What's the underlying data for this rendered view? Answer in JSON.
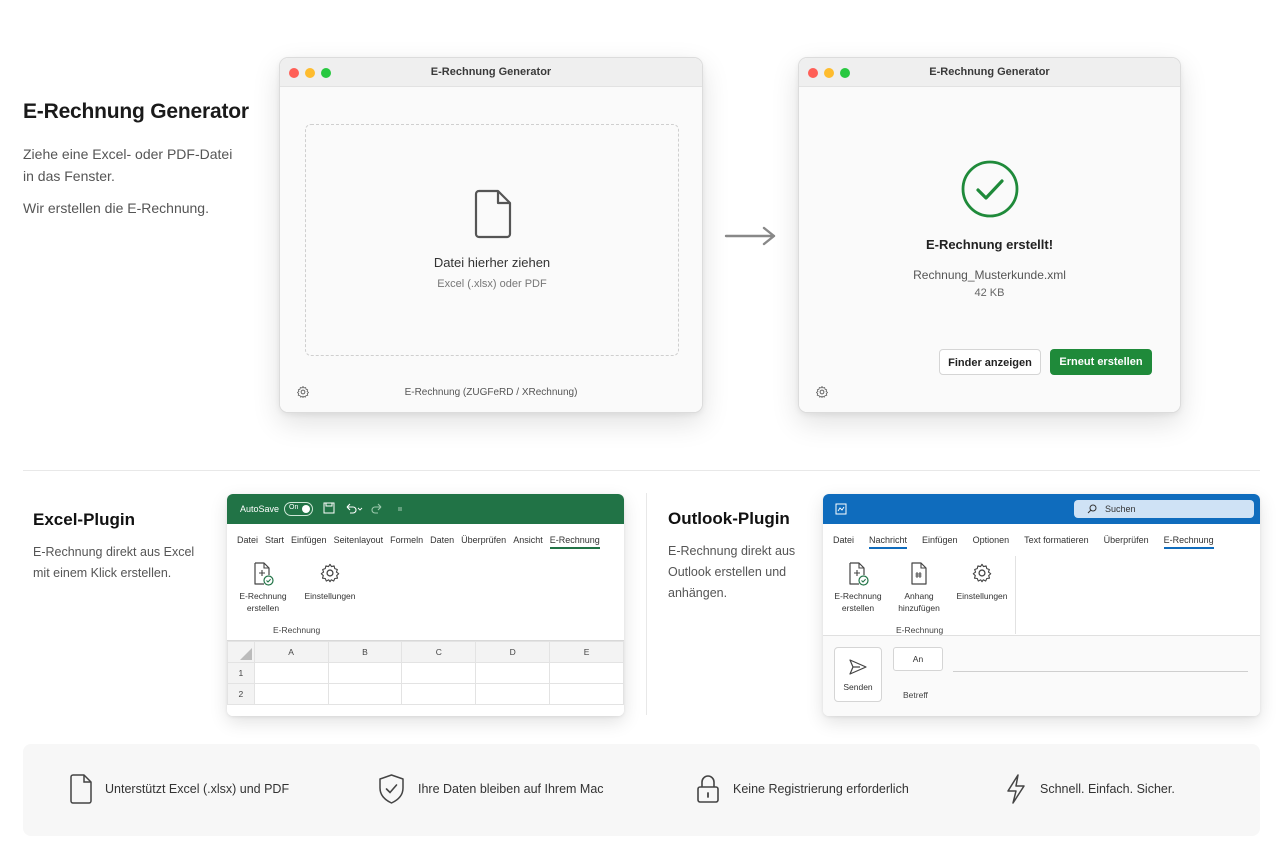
{
  "intro": {
    "title": "E-Rechnung Generator",
    "line1": "Ziehe eine Excel- oder PDF-Datei in das Fenster.",
    "line2": "Wir erstellen die E-Rechnung."
  },
  "window_left": {
    "title": "E-Rechnung Generator",
    "drop_title": "Datei hierher ziehen",
    "drop_subtitle": "Excel (.xlsx) oder PDF",
    "footer": "E-Rechnung (ZUGFeRD / XRechnung)"
  },
  "window_right": {
    "title": "E-Rechnung Generator",
    "status": "E-Rechnung erstellt!",
    "filename": "Rechnung_Musterkunde.xml",
    "filesize": "42 KB",
    "secondary_button": "Finder anzeigen",
    "primary_button": "Erneut erstellen"
  },
  "excel_plugin": {
    "title": "Excel-Plugin",
    "description": "E-Rechnung direkt aus Excel mit einem Klick erstellen.",
    "autosave": "AutoSave",
    "toggle": "On",
    "tabs": [
      "Datei",
      "Start",
      "Einfügen",
      "Seitenlayout",
      "Formeln",
      "Daten",
      "Überprüfen",
      "Ansicht",
      "E-Rechnung"
    ],
    "btn_create_line1": "E-Rechnung",
    "btn_create_line2": "erstellen",
    "btn_settings": "Einstellungen",
    "group": "E-Rechnung",
    "columns": [
      "A",
      "B",
      "C",
      "D",
      "E"
    ],
    "rows": [
      "1",
      "2"
    ]
  },
  "outlook_plugin": {
    "title": "Outlook-Plugin",
    "description": "E-Rechnung direkt aus Outlook erstellen und anhängen.",
    "search": "Suchen",
    "tabs": [
      "Datei",
      "Nachricht",
      "Einfügen",
      "Optionen",
      "Text formatieren",
      "Überprüfen",
      "E-Rechnung"
    ],
    "btn_create_line1": "E-Rechnung",
    "btn_create_line2": "erstellen",
    "btn_attach_line1": "Anhang",
    "btn_attach_line2": "hinzufügen",
    "btn_settings": "Einstellungen",
    "group": "E-Rechnung",
    "send": "Senden",
    "to": "An",
    "subject": "Betreff"
  },
  "features": [
    {
      "icon": "file-icon",
      "text": "Unterstützt Excel (.xlsx) und PDF"
    },
    {
      "icon": "shield-check-icon",
      "text": "Ihre Daten bleiben auf Ihrem Mac"
    },
    {
      "icon": "lock-icon",
      "text": "Keine Registrierung erforderlich"
    },
    {
      "icon": "lightning-icon",
      "text": "Schnell. Einfach. Sicher."
    }
  ],
  "colors": {
    "excel_green": "#217346",
    "outlook_blue": "#0f6cbd",
    "success_green": "#1f8a3a"
  }
}
